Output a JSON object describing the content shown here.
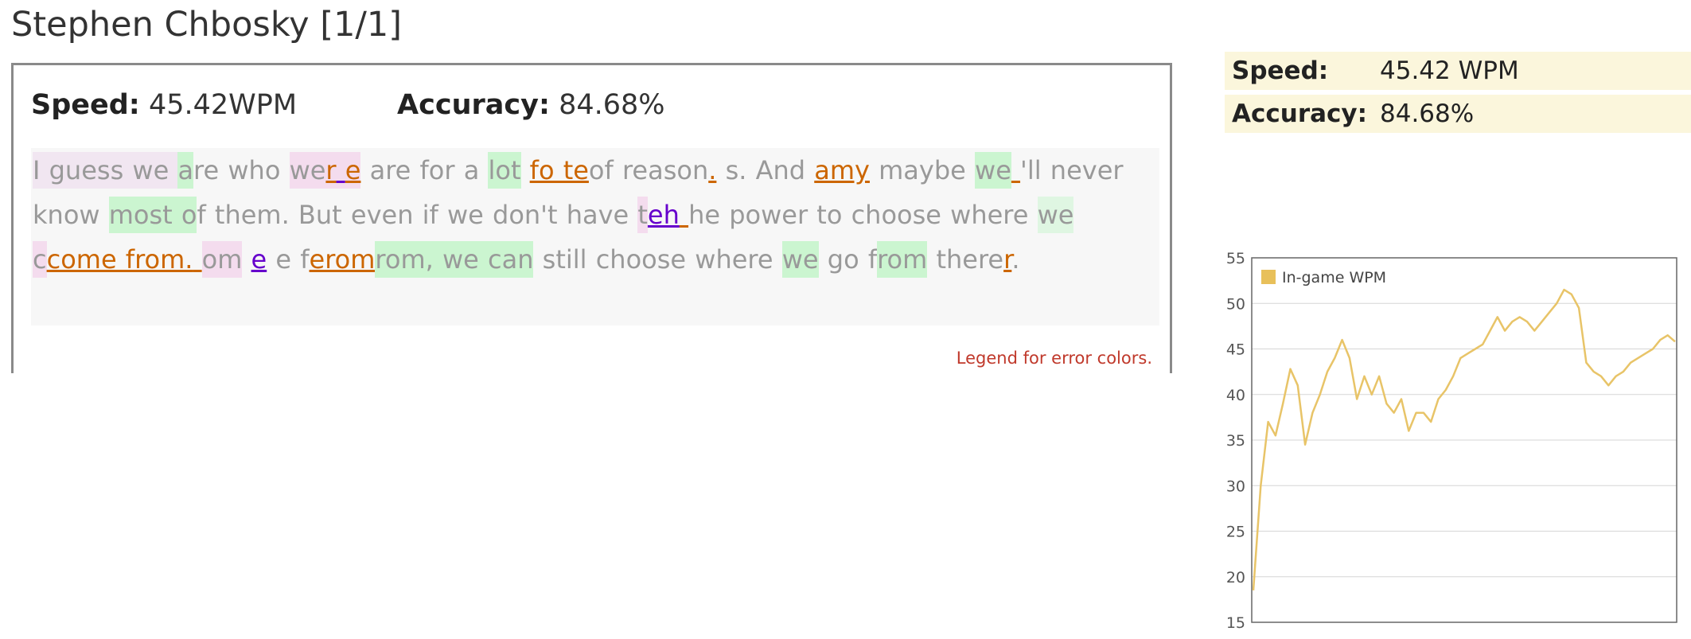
{
  "title": "Stephen Chbosky [1/1]",
  "stats": {
    "speed_label": "Speed:",
    "speed_value": "45.42WPM",
    "accuracy_label": "Accuracy:",
    "accuracy_value": "84.68%"
  },
  "legend_link": "Legend for error colors.",
  "side_stats": {
    "speed_label": "Speed:",
    "speed_value": "45.42 WPM",
    "accuracy_label": "Accuracy:",
    "accuracy_value": "84.68%"
  },
  "typed_segments": [
    {
      "t": "I guess we ",
      "c": "ep"
    },
    {
      "t": "a",
      "c": "g"
    },
    {
      "t": "re who ",
      "c": ""
    },
    {
      "t": "we",
      "c": "p"
    },
    {
      "t": "r",
      "c": "o p"
    },
    {
      "t": " ",
      "c": "b p"
    },
    {
      "t": "e",
      "c": "o p"
    },
    {
      "t": " are for a ",
      "c": ""
    },
    {
      "t": "lot",
      "c": "g"
    },
    {
      "t": " ",
      "c": ""
    },
    {
      "t": "fo te",
      "c": "o"
    },
    {
      "t": "of reason",
      "c": ""
    },
    {
      "t": ".",
      "c": "o"
    },
    {
      "t": " s. And ",
      "c": ""
    },
    {
      "t": "amy",
      "c": "o"
    },
    {
      "t": " maybe ",
      "c": ""
    },
    {
      "t": "we",
      "c": "g"
    },
    {
      "t": " ",
      "c": "o"
    },
    {
      "t": "'ll never know ",
      "c": ""
    },
    {
      "t": "most o",
      "c": "g"
    },
    {
      "t": "f them. But even if we don't have ",
      "c": ""
    },
    {
      "t": "t",
      "c": "p"
    },
    {
      "t": "eh",
      "c": "b"
    },
    {
      "t": " ",
      "c": "o"
    },
    {
      "t": "he power to choose where ",
      "c": ""
    },
    {
      "t": "we ",
      "c": "g2"
    },
    {
      "t": "c",
      "c": "p"
    },
    {
      "t": "come from.",
      "c": "o"
    },
    {
      "t": " ",
      "c": "o"
    },
    {
      "t": "om",
      "c": "p"
    },
    {
      "t": " ",
      "c": ""
    },
    {
      "t": "e",
      "c": "b"
    },
    {
      "t": " e f",
      "c": ""
    },
    {
      "t": "erom",
      "c": "o"
    },
    {
      "t": "rom, we",
      "c": "g"
    },
    {
      "t": " can",
      "c": "g"
    },
    {
      "t": " still choose where ",
      "c": ""
    },
    {
      "t": "we",
      "c": "g"
    },
    {
      "t": " go f",
      "c": ""
    },
    {
      "t": "rom",
      "c": "g"
    },
    {
      "t": " there",
      "c": ""
    },
    {
      "t": "r",
      "c": "o"
    },
    {
      "t": ".",
      "c": ""
    }
  ],
  "colors": {
    "line": "#e8c468",
    "legend_swatch": "#e8c05a",
    "error_orange": "#cc6600",
    "error_blue": "#6600cc",
    "legend_link": "#c0392b",
    "stats_bg": "#fbf6dc"
  },
  "chart_data": {
    "type": "line",
    "ylim": [
      15,
      55
    ],
    "yticks": [
      "55",
      "50",
      "45",
      "40",
      "35",
      "30",
      "25",
      "20",
      "15"
    ],
    "grid": true,
    "legend_position": "top-left",
    "series": [
      {
        "name": "In-game WPM",
        "values": [
          18.5,
          30,
          37,
          35.5,
          39,
          42.8,
          41,
          34.5,
          38,
          40,
          42.5,
          44,
          46,
          44,
          39.5,
          42,
          40,
          42,
          39,
          38,
          39.5,
          36,
          38,
          38,
          37,
          39.5,
          40.5,
          42,
          44,
          44.5,
          45,
          45.5,
          47,
          48.5,
          47,
          48,
          48.5,
          48,
          47,
          48,
          49,
          50,
          51.5,
          51,
          49.5,
          43.5,
          42.5,
          42,
          41,
          42,
          42.5,
          43.5,
          44,
          44.5,
          45,
          46,
          46.5,
          45.8
        ]
      }
    ]
  }
}
